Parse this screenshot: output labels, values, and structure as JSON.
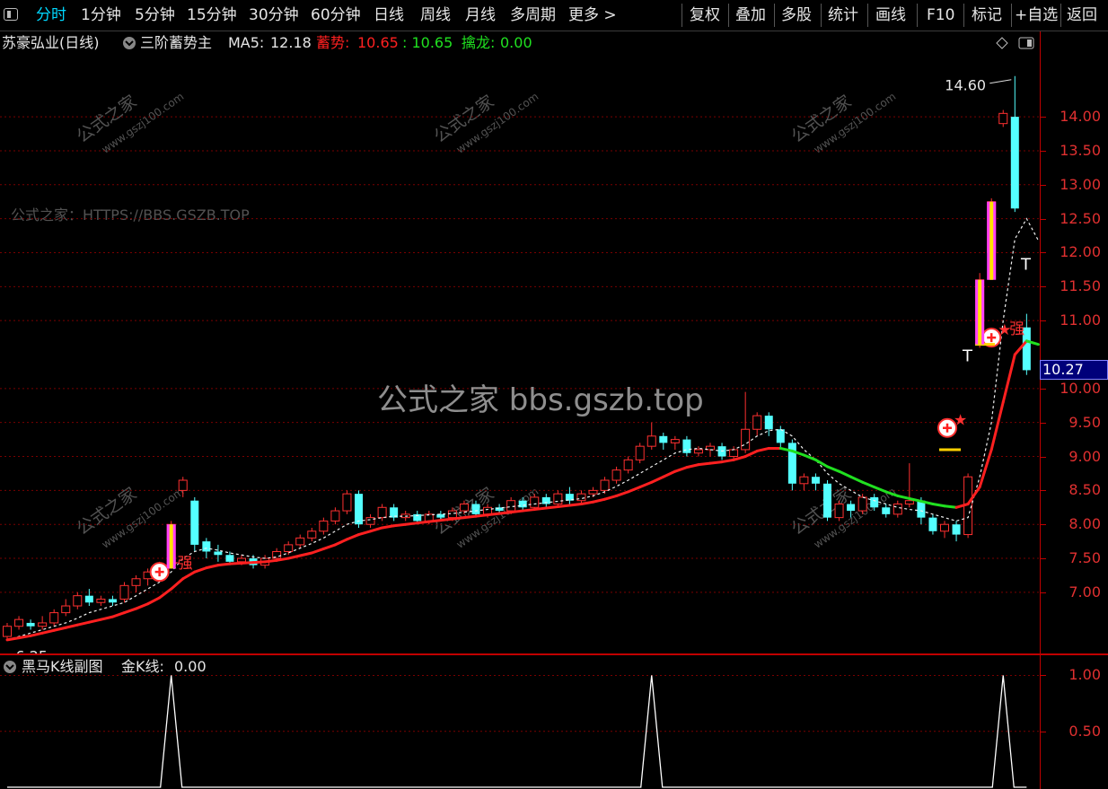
{
  "toolbar": {
    "menu_icon": "menu-icon",
    "period_tabs": [
      "分时",
      "1分钟",
      "5分钟",
      "15分钟",
      "30分钟",
      "60分钟",
      "日线",
      "周线",
      "月线",
      "多周期",
      "更多 >"
    ],
    "active_tab": "分时",
    "right_buttons": [
      "复权",
      "叠加",
      "多股",
      "统计",
      "画线",
      "F10",
      "标记",
      "+自选",
      "返回"
    ]
  },
  "title": {
    "stock_name": "苏豪弘业(日线)",
    "indicator": "三阶蓄势主",
    "ma5_label": "MA5:",
    "ma5_value": "12.18",
    "xushi_label": "蓄势:",
    "xushi_value1": "10.65",
    "xushi_value2": ": 10.65",
    "qinlong_label": "擒龙:",
    "qinlong_value": "0.00",
    "collapse_icon": "chevron-down-icon",
    "diamond_icon": "diamond-icon",
    "window_icon": "window-icon"
  },
  "watermarks": {
    "site_cn": "公式之家",
    "site_url": "www.gszj100.com",
    "bbs": "公式之家：HTTPS://BBS.GSZB.TOP",
    "center": "公式之家 bbs.gszb.top"
  },
  "main_axis": {
    "labels": [
      "14.00",
      "13.50",
      "13.00",
      "12.50",
      "12.00",
      "11.50",
      "11.00",
      "10.00",
      "9.50",
      "9.00",
      "8.50",
      "8.00",
      "7.50",
      "7.00"
    ],
    "current_price": "10.27"
  },
  "annotations": {
    "high_label": "14.60",
    "low_label": "6.25",
    "strong_label": "强",
    "strong_icon": "red-star-icon",
    "buy_icon": "plus-circle-icon"
  },
  "sub_panel": {
    "title": "黑马K线副图",
    "gold_label": "金K线:",
    "gold_value": "0.00",
    "axis_labels": [
      "1.00",
      "0.50"
    ]
  },
  "colors": {
    "up": "#ff3030",
    "down": "#54ffff",
    "ma_red": "#ff2020",
    "ma_green": "#20e020",
    "axis": "#c00000"
  },
  "chart_data": {
    "type": "candlestick",
    "title": "苏豪弘业(日线)",
    "ylim": [
      6.1,
      14.9
    ],
    "y_ticks": [
      7.0,
      7.5,
      8.0,
      8.5,
      9.0,
      9.5,
      10.0,
      11.0,
      11.5,
      12.0,
      12.5,
      13.0,
      13.5,
      14.0
    ],
    "grid": true,
    "high": 14.6,
    "low": 6.25,
    "last": 10.27,
    "candles": [
      [
        6.35,
        6.5,
        6.3,
        6.55
      ],
      [
        6.5,
        6.6,
        6.45,
        6.65
      ],
      [
        6.55,
        6.5,
        6.45,
        6.6
      ],
      [
        6.5,
        6.55,
        6.45,
        6.65
      ],
      [
        6.55,
        6.7,
        6.5,
        6.75
      ],
      [
        6.7,
        6.8,
        6.65,
        6.9
      ],
      [
        6.8,
        6.95,
        6.75,
        7.0
      ],
      [
        6.95,
        6.85,
        6.8,
        7.05
      ],
      [
        6.85,
        6.9,
        6.8,
        6.95
      ],
      [
        6.9,
        6.85,
        6.8,
        6.95
      ],
      [
        6.9,
        7.1,
        6.85,
        7.15
      ],
      [
        7.1,
        7.2,
        7.0,
        7.25
      ],
      [
        7.2,
        7.3,
        7.1,
        7.35
      ],
      [
        7.3,
        7.4,
        7.25,
        7.45
      ],
      [
        7.4,
        8.0,
        7.35,
        8.05
      ],
      [
        8.5,
        8.65,
        8.4,
        8.7
      ],
      [
        8.35,
        7.7,
        7.6,
        8.4
      ],
      [
        7.75,
        7.6,
        7.5,
        7.8
      ],
      [
        7.6,
        7.55,
        7.45,
        7.7
      ],
      [
        7.55,
        7.45,
        7.4,
        7.6
      ],
      [
        7.45,
        7.5,
        7.4,
        7.55
      ],
      [
        7.5,
        7.4,
        7.35,
        7.55
      ],
      [
        7.4,
        7.5,
        7.35,
        7.55
      ],
      [
        7.5,
        7.6,
        7.45,
        7.65
      ],
      [
        7.6,
        7.7,
        7.55,
        7.75
      ],
      [
        7.7,
        7.8,
        7.65,
        7.85
      ],
      [
        7.8,
        7.9,
        7.75,
        7.95
      ],
      [
        7.9,
        8.05,
        7.85,
        8.1
      ],
      [
        8.05,
        8.2,
        8.0,
        8.25
      ],
      [
        8.2,
        8.45,
        8.15,
        8.5
      ],
      [
        8.45,
        8.0,
        7.95,
        8.5
      ],
      [
        8.0,
        8.1,
        7.95,
        8.15
      ],
      [
        8.1,
        8.25,
        8.05,
        8.3
      ],
      [
        8.25,
        8.1,
        8.05,
        8.3
      ],
      [
        8.1,
        8.15,
        8.05,
        8.2
      ],
      [
        8.15,
        8.05,
        8.0,
        8.2
      ],
      [
        8.05,
        8.15,
        8.0,
        8.2
      ],
      [
        8.15,
        8.1,
        8.05,
        8.2
      ],
      [
        8.1,
        8.2,
        8.05,
        8.25
      ],
      [
        8.2,
        8.3,
        8.15,
        8.35
      ],
      [
        8.3,
        8.15,
        8.1,
        8.35
      ],
      [
        8.15,
        8.25,
        8.1,
        8.3
      ],
      [
        8.25,
        8.2,
        8.15,
        8.3
      ],
      [
        8.2,
        8.35,
        8.15,
        8.4
      ],
      [
        8.35,
        8.25,
        8.2,
        8.4
      ],
      [
        8.25,
        8.4,
        8.2,
        8.45
      ],
      [
        8.4,
        8.3,
        8.25,
        8.45
      ],
      [
        8.3,
        8.45,
        8.25,
        8.5
      ],
      [
        8.45,
        8.35,
        8.3,
        8.55
      ],
      [
        8.35,
        8.45,
        8.3,
        8.5
      ],
      [
        8.45,
        8.5,
        8.4,
        8.55
      ],
      [
        8.5,
        8.65,
        8.45,
        8.7
      ],
      [
        8.65,
        8.8,
        8.6,
        8.85
      ],
      [
        8.8,
        8.95,
        8.75,
        9.0
      ],
      [
        8.95,
        9.15,
        8.9,
        9.2
      ],
      [
        9.15,
        9.3,
        9.1,
        9.5
      ],
      [
        9.3,
        9.2,
        9.1,
        9.35
      ],
      [
        9.2,
        9.25,
        9.1,
        9.3
      ],
      [
        9.25,
        9.05,
        9.0,
        9.3
      ],
      [
        9.05,
        9.1,
        9.0,
        9.15
      ],
      [
        9.1,
        9.15,
        9.0,
        9.2
      ],
      [
        9.15,
        9.0,
        8.95,
        9.2
      ],
      [
        9.0,
        9.1,
        8.95,
        9.15
      ],
      [
        9.1,
        9.4,
        9.05,
        9.95
      ],
      [
        9.4,
        9.6,
        9.3,
        9.65
      ],
      [
        9.6,
        9.4,
        9.3,
        9.65
      ],
      [
        9.4,
        9.2,
        9.1,
        9.45
      ],
      [
        9.2,
        8.6,
        8.5,
        9.25
      ],
      [
        8.6,
        8.7,
        8.5,
        8.75
      ],
      [
        8.7,
        8.6,
        8.5,
        8.75
      ],
      [
        8.6,
        8.1,
        8.05,
        8.65
      ],
      [
        8.1,
        8.3,
        8.05,
        8.35
      ],
      [
        8.3,
        8.2,
        8.1,
        8.35
      ],
      [
        8.2,
        8.4,
        8.15,
        8.45
      ],
      [
        8.4,
        8.25,
        8.2,
        8.45
      ],
      [
        8.25,
        8.15,
        8.1,
        8.3
      ],
      [
        8.15,
        8.3,
        8.1,
        8.35
      ],
      [
        8.3,
        8.35,
        8.25,
        8.9
      ],
      [
        8.35,
        8.1,
        8.0,
        8.4
      ],
      [
        8.1,
        7.9,
        7.85,
        8.15
      ],
      [
        7.9,
        8.0,
        7.8,
        8.05
      ],
      [
        8.0,
        7.85,
        7.75,
        8.05
      ],
      [
        7.85,
        8.7,
        7.8,
        8.75
      ],
      [
        10.65,
        11.6,
        10.6,
        11.7
      ],
      [
        12.0,
        12.75,
        11.9,
        12.8
      ],
      [
        13.9,
        14.05,
        13.85,
        14.1
      ],
      [
        14.0,
        12.65,
        12.6,
        14.6
      ],
      [
        10.9,
        10.27,
        10.2,
        11.1
      ]
    ],
    "series": [
      {
        "name": "MA5",
        "values": [
          6.3,
          6.35,
          6.4,
          6.45,
          6.5,
          6.55,
          6.62,
          6.7,
          6.75,
          6.8,
          6.85,
          6.95,
          7.05,
          7.15,
          7.3,
          7.5,
          7.6,
          7.65,
          7.62,
          7.58,
          7.55,
          7.52,
          7.5,
          7.52,
          7.58,
          7.65,
          7.72,
          7.8,
          7.9,
          8.0,
          8.05,
          8.07,
          8.1,
          8.12,
          8.12,
          8.13,
          8.14,
          8.15,
          8.16,
          8.18,
          8.2,
          8.22,
          8.24,
          8.26,
          8.28,
          8.3,
          8.32,
          8.34,
          8.36,
          8.38,
          8.42,
          8.48,
          8.56,
          8.65,
          8.75,
          8.85,
          8.95,
          9.05,
          9.1,
          9.12,
          9.1,
          9.08,
          9.1,
          9.18,
          9.3,
          9.38,
          9.4,
          9.3,
          9.1,
          8.95,
          8.75,
          8.6,
          8.5,
          8.4,
          8.35,
          8.3,
          8.25,
          8.22,
          8.2,
          8.15,
          8.1,
          8.05,
          8.1,
          8.7,
          9.5,
          11.0,
          12.2,
          12.5,
          12.18
        ]
      },
      {
        "name": "蓄势",
        "values": [
          6.3,
          6.33,
          6.36,
          6.4,
          6.44,
          6.48,
          6.52,
          6.56,
          6.6,
          6.64,
          6.7,
          6.76,
          6.83,
          6.92,
          7.05,
          7.2,
          7.3,
          7.36,
          7.4,
          7.42,
          7.43,
          7.44,
          7.45,
          7.47,
          7.5,
          7.54,
          7.58,
          7.64,
          7.7,
          7.78,
          7.85,
          7.9,
          7.95,
          7.98,
          8.0,
          8.02,
          8.04,
          8.06,
          8.08,
          8.1,
          8.12,
          8.14,
          8.16,
          8.18,
          8.2,
          8.22,
          8.24,
          8.26,
          8.28,
          8.3,
          8.33,
          8.37,
          8.42,
          8.48,
          8.55,
          8.62,
          8.7,
          8.78,
          8.84,
          8.88,
          8.9,
          8.92,
          8.95,
          9.0,
          9.08,
          9.12,
          9.12,
          9.08,
          9.02,
          8.95,
          8.85,
          8.78,
          8.7,
          8.62,
          8.55,
          8.48,
          8.42,
          8.38,
          8.34,
          8.3,
          8.27,
          8.25,
          8.3,
          8.55,
          9.1,
          9.8,
          10.5,
          10.7,
          10.65
        ]
      }
    ],
    "sub_chart": {
      "name": "金K线",
      "ylim": [
        0,
        1.1
      ],
      "y_ticks": [
        0.5,
        1.0
      ],
      "spike_indices": [
        14,
        55,
        85
      ],
      "spike_value": 1.0
    }
  }
}
